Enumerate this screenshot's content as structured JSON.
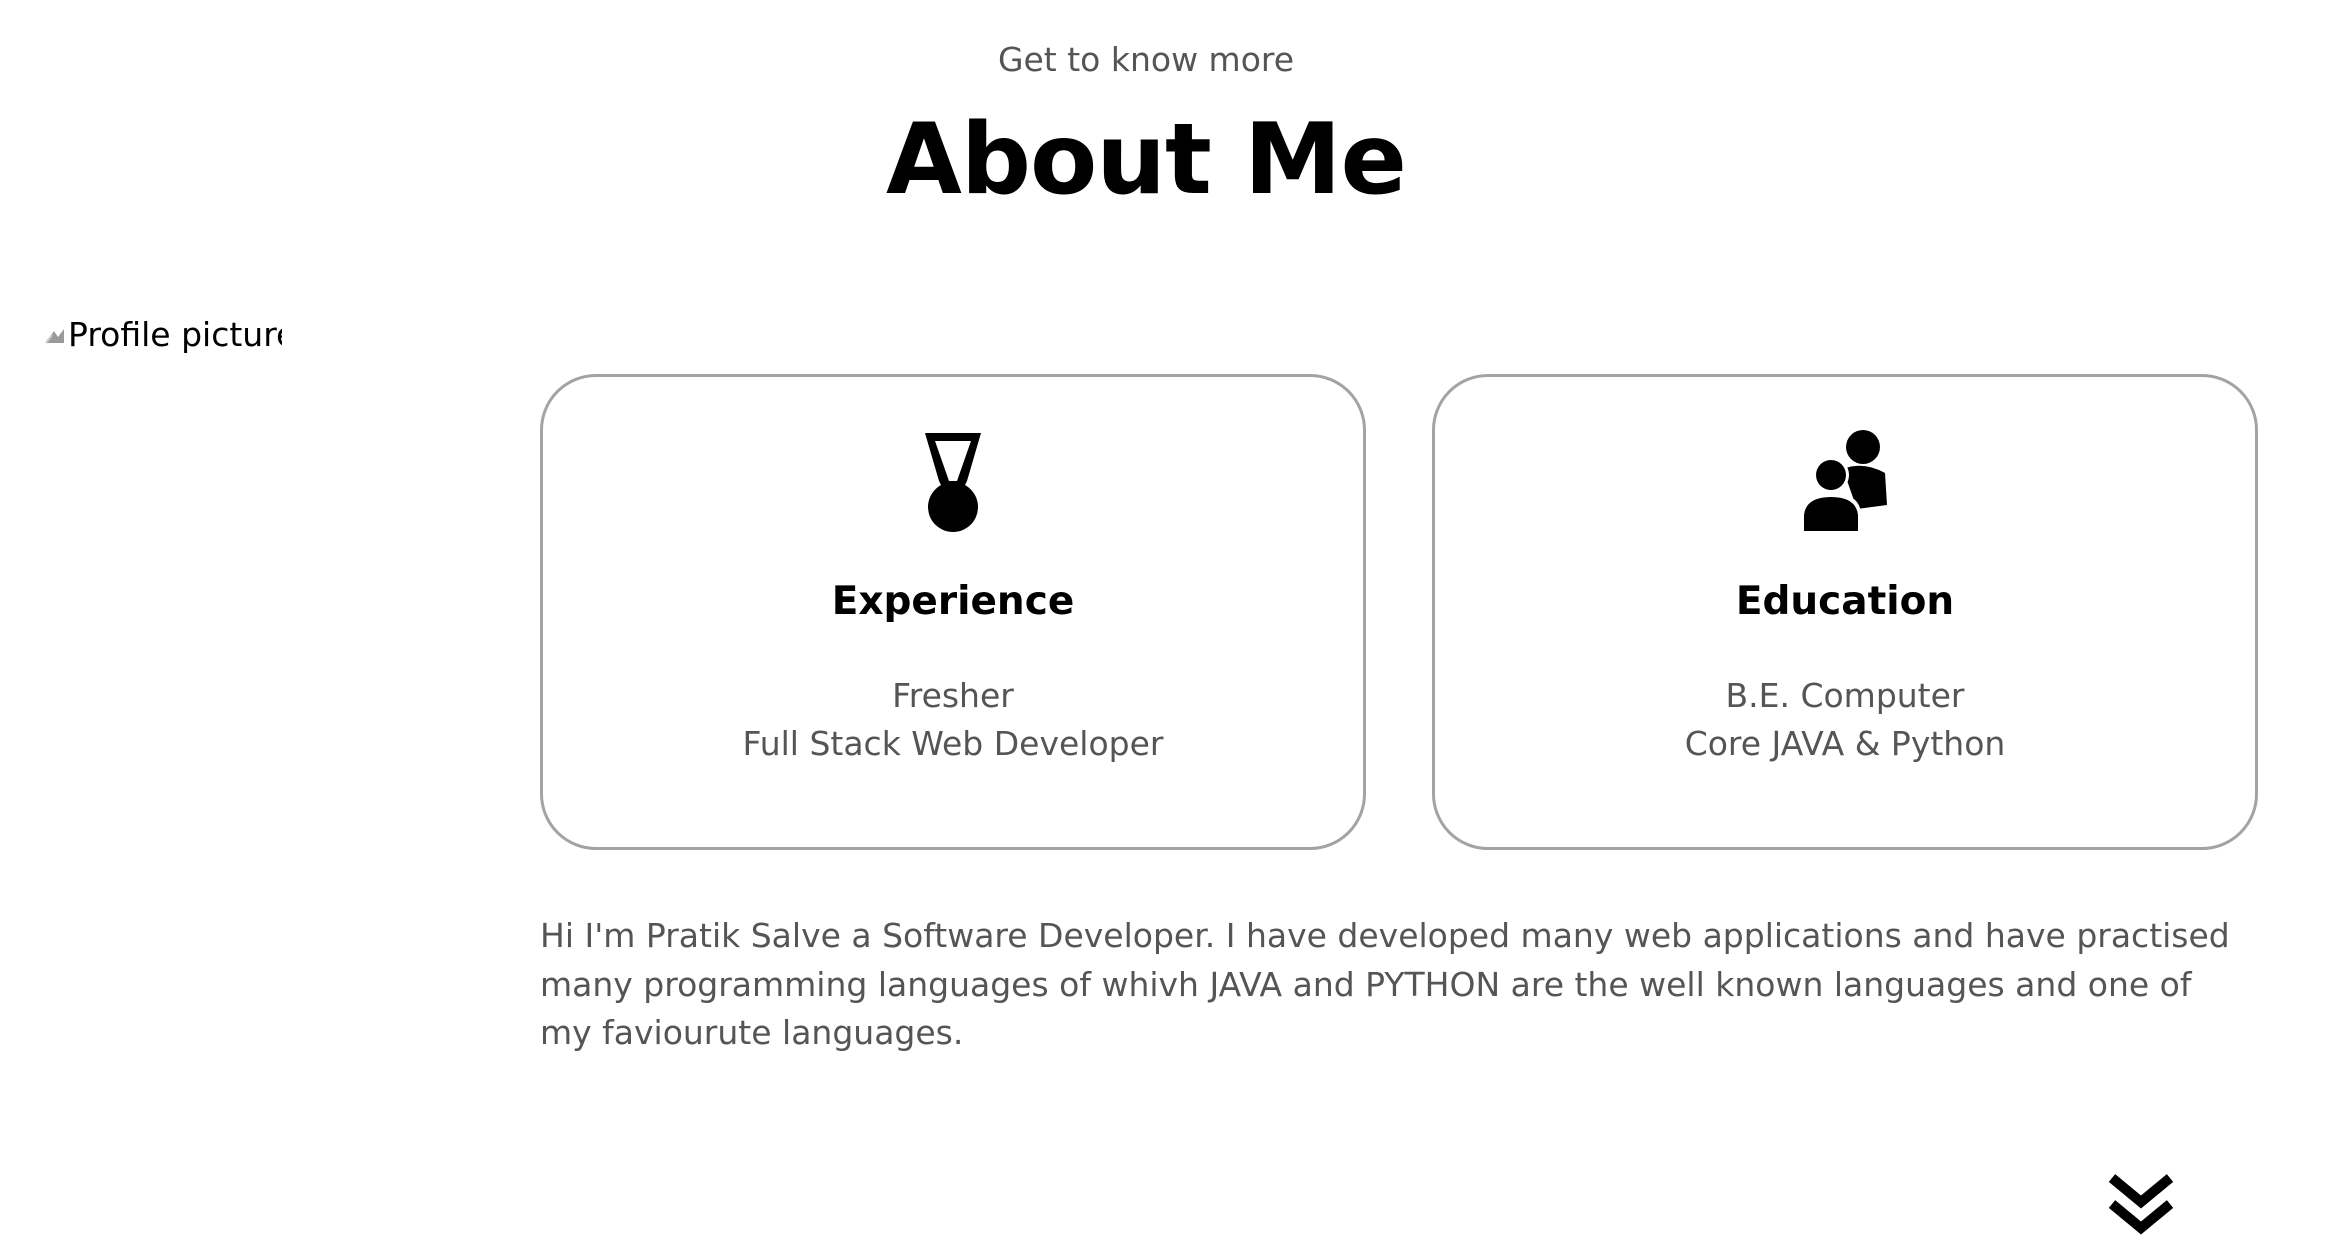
{
  "header": {
    "subtitle": "Get to know more",
    "title": "About Me"
  },
  "profile": {
    "image_alt": "Profile picture"
  },
  "cards": [
    {
      "icon": "medal-icon",
      "heading": "Experience",
      "line1": "Fresher",
      "line2": "Full Stack Web Developer"
    },
    {
      "icon": "users-icon",
      "heading": "Education",
      "line1": "B.E. Computer",
      "line2": "Core JAVA & Python"
    }
  ],
  "about": {
    "text": "Hi I'm Pratik Salve a Software Developer. I have developed many web applications and have practised many programming languages of whivh JAVA and PYTHON are the well known languages and one of my faviourute languages."
  },
  "navigation": {
    "scroll_icon": "double-chevron-down-icon"
  }
}
